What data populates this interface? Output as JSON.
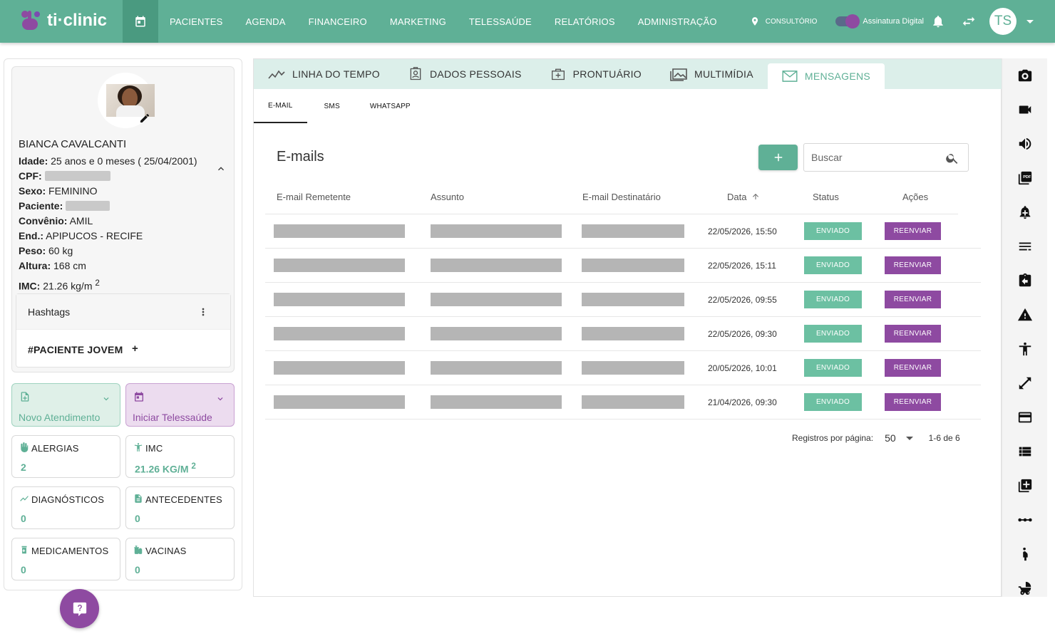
{
  "app": {
    "logo_text": "ti·clinic"
  },
  "nav": {
    "items": [
      "PACIENTES",
      "AGENDA",
      "FINANCEIRO",
      "MARKETING",
      "TELESSAÚDE",
      "RELATÓRIOS",
      "ADMINISTRAÇÃO"
    ],
    "location_label": "CONSULTÓRIO",
    "signature_label": "Assinatura Digital",
    "user_initials": "TS"
  },
  "patient": {
    "name": "BIANCA CAVALCANTI",
    "age_label": "Idade:",
    "age_value": " 25 anos e 0 meses ( 25/04/2001)",
    "cpf_label": "CPF:",
    "sex_label": "Sexo:",
    "sex_value": " FEMININO",
    "patient_label": "Paciente:",
    "insurance_label": "Convênio:",
    "insurance_value": " AMIL",
    "address_label": "End.:",
    "address_value": " APIPUCOS -  RECIFE",
    "weight_label": "Peso:",
    "weight_value": " 60 kg",
    "height_label": "Altura:",
    "height_value": " 168 cm",
    "bmi_label": "IMC:",
    "bmi_value": " 21.26 kg/m",
    "bmi_sup": "2"
  },
  "hashtags": {
    "title": "Hashtags",
    "tag": "#PACIENTE JOVEM",
    "add": "+"
  },
  "actions": {
    "new_visit": "Novo Atendimento",
    "start_tele": "Iniciar Telessaúde"
  },
  "stats": {
    "allergies": {
      "title": "ALERGIAS",
      "value": "2"
    },
    "bmi": {
      "title": "IMC",
      "value": "21.26 KG/M",
      "sup": "2"
    },
    "diagnoses": {
      "title": "DIAGNÓSTICOS",
      "value": "0"
    },
    "history": {
      "title": "ANTECEDENTES",
      "value": "0"
    },
    "medications": {
      "title": "MEDICAMENTOS",
      "value": "0"
    },
    "vaccines": {
      "title": "VACINAS",
      "value": "0"
    }
  },
  "tabs": [
    {
      "label": "LINHA DO TEMPO",
      "icon": "timeline-icon"
    },
    {
      "label": "DADOS PESSOAIS",
      "icon": "id-card-icon"
    },
    {
      "label": "PRONTUÁRIO",
      "icon": "medical-record-icon"
    },
    {
      "label": "MULTIMÍDIA",
      "icon": "image-icon"
    },
    {
      "label": "MENSAGENS",
      "icon": "mail-icon"
    }
  ],
  "subtabs": [
    "E-MAIL",
    "SMS",
    "WHATSAPP"
  ],
  "emails": {
    "title": "E-mails",
    "search_placeholder": "Buscar",
    "columns": [
      "E-mail Remetente",
      "Assunto",
      "E-mail Destinatário",
      "Data",
      "Status",
      "Ações"
    ],
    "rows": [
      {
        "date": "22/05/2026, 15:50",
        "status": "ENVIADO",
        "action": "REENVIAR"
      },
      {
        "date": "22/05/2026, 15:11",
        "status": "ENVIADO",
        "action": "REENVIAR"
      },
      {
        "date": "22/05/2026, 09:55",
        "status": "ENVIADO",
        "action": "REENVIAR"
      },
      {
        "date": "22/05/2026, 09:30",
        "status": "ENVIADO",
        "action": "REENVIAR"
      },
      {
        "date": "20/05/2026, 10:01",
        "status": "ENVIADO",
        "action": "REENVIAR"
      },
      {
        "date": "21/04/2026, 09:30",
        "status": "ENVIADO",
        "action": "REENVIAR"
      }
    ],
    "pager": {
      "label": "Registros por página:",
      "per_page": "50",
      "range": "1-6 de 6"
    }
  },
  "right_toolbar": [
    "camera-icon",
    "video-icon",
    "volume-icon",
    "pdf-icon",
    "alarm-add-icon",
    "notes-icon",
    "clipboard-icon",
    "warning-icon",
    "accessibility-icon",
    "resize-icon",
    "card-icon",
    "list-icon",
    "add-box-icon",
    "more-icon",
    "pregnant-icon",
    "stroller-icon"
  ],
  "colors": {
    "brand": "#5fb096",
    "accent": "#8e4aa1",
    "status_sent": "#6cc0a2"
  }
}
